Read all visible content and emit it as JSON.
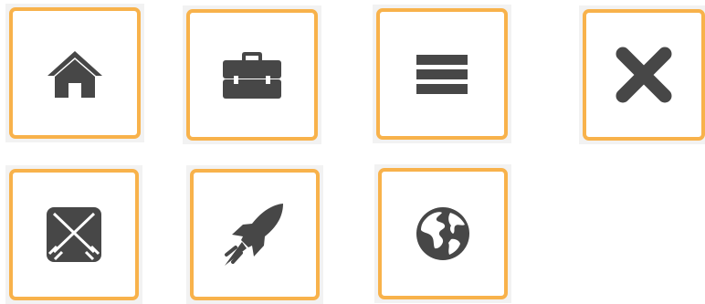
{
  "colors": {
    "tile_border": "#f8b24b",
    "tile_background": "#ffffff",
    "tile_shadow": "#f2f2f2",
    "icon": "#474747"
  },
  "tiles": [
    {
      "icon": "home-icon"
    },
    {
      "icon": "briefcase-icon"
    },
    {
      "icon": "menu-icon"
    },
    {
      "icon": "close-icon"
    },
    {
      "icon": "crossed-swords-icon"
    },
    {
      "icon": "rocket-icon"
    },
    {
      "icon": "globe-icon"
    }
  ]
}
